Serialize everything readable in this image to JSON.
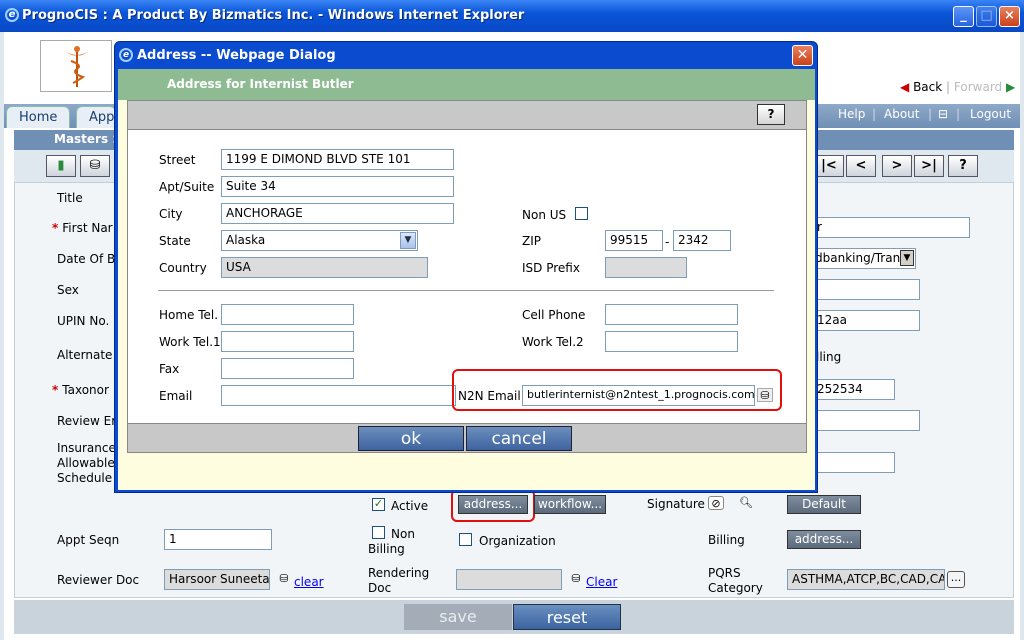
{
  "window": {
    "title": "PrognoCIS : A Product By Bizmatics Inc. - Windows Internet Explorer"
  },
  "nav": {
    "tabs": [
      "Home",
      "App"
    ],
    "help": "Help",
    "about": "About",
    "logout": "Logout",
    "back": "Back",
    "forward": "Forward",
    "masters": "Masters >"
  },
  "form": {
    "title_label": "Title",
    "first_name_label": "First Nar",
    "dob_label": "Date Of Bi",
    "sex_label": "Sex",
    "upin_label": "UPIN No.",
    "alternate_label": "Alternate M",
    "taxonomy_label": "Taxonor",
    "review_label": "Review Er",
    "insurance_label_1": "Insurance",
    "insurance_label_2": "Allowable",
    "insurance_label_3": "Schedule",
    "right_first_name_partial": "r",
    "right_dropdown_partial": "dbanking/Trans",
    "right_upin_partial": "12aa",
    "right_billing_partial": "lling",
    "right_taxonomy_partial": "252534",
    "active_label": "Active",
    "address_btn": "address...",
    "workflow_btn": "workflow...",
    "signature_label": "Signature",
    "default_btn": "Default",
    "appt_seqn_label": "Appt Seqn",
    "appt_seqn_value": "1",
    "non_billing_label_1": "Non",
    "non_billing_label_2": "Billing",
    "organization_label": "Organization",
    "billing_label": "Billing",
    "billing_address_btn": "address...",
    "reviewer_doc_label": "Reviewer Doc",
    "reviewer_doc_value": "Harsoor Suneeta",
    "clear_link": "clear",
    "rendering_doc_label_1": "Rendering",
    "rendering_doc_label_2": "Doc",
    "clear_link_2": "Clear",
    "pqrs_label_1": "PQRS",
    "pqrs_label_2": "Category",
    "pqrs_value": "ASTHMA,ATCP,BC,CAD,CAT",
    "pqrs_more": "...",
    "save_btn": "save",
    "reset_btn": "reset",
    "toolbar_right": [
      "|<",
      "<",
      ">",
      ">|",
      "?"
    ]
  },
  "dialog": {
    "title": "Address -- Webpage Dialog",
    "header": "Address for Internist Butler",
    "help": "?",
    "street_label": "Street",
    "street_value": "1199 E DIMOND BLVD STE 101",
    "apt_label": "Apt/Suite",
    "apt_value": "Suite 34",
    "city_label": "City",
    "city_value": "ANCHORAGE",
    "non_us_label": "Non US",
    "state_label": "State",
    "state_value": "Alaska",
    "zip_label": "ZIP",
    "zip_value": "99515",
    "zip_sep": "-",
    "zip_ext_value": "2342",
    "country_label": "Country",
    "country_value": "USA",
    "isd_label": "ISD Prefix",
    "isd_value": "",
    "home_tel_label": "Home Tel.",
    "cell_phone_label": "Cell Phone",
    "work_tel1_label": "Work Tel.1",
    "work_tel2_label": "Work Tel.2",
    "fax_label": "Fax",
    "email_label": "Email",
    "email_value": "",
    "n2n_label": "N2N Email",
    "n2n_value": "butlerinternist@n2ntest_1.prognocis.com",
    "ok_btn": "ok",
    "cancel_btn": "cancel"
  },
  "colors": {
    "titlebar": "#0a56d8",
    "dialog_header": "#8fbb93",
    "highlight": "#e01010"
  }
}
